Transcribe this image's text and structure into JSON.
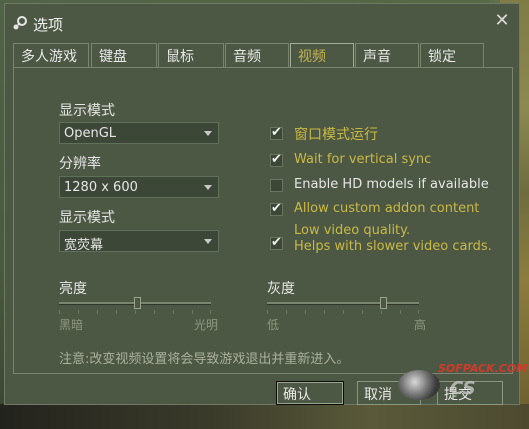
{
  "window": {
    "title": "选项",
    "close_glyph": "✕"
  },
  "tabs": [
    {
      "label": "多人游戏"
    },
    {
      "label": "键盘"
    },
    {
      "label": "鼠标"
    },
    {
      "label": "音频"
    },
    {
      "label": "视频",
      "active": true
    },
    {
      "label": "声音"
    },
    {
      "label": "锁定"
    }
  ],
  "video": {
    "display_mode_label": "显示模式",
    "renderer_value": "OpenGL",
    "resolution_label": "分辨率",
    "resolution_value": "1280 x 600",
    "display_mode2_label": "显示模式",
    "aspect_value": "宽荧幕",
    "options": [
      {
        "label": "窗口模式运行",
        "checked": true,
        "color": "#c9b945"
      },
      {
        "label": "Wait for vertical sync",
        "checked": true,
        "color": "#c9b945"
      },
      {
        "label": "Enable HD models if available",
        "checked": false,
        "color": "#e6e6e6"
      },
      {
        "label": "Allow custom addon content",
        "checked": true,
        "color": "#c9b945"
      },
      {
        "label_line1": "Low video quality.",
        "label_line2": "Helps with slower video cards.",
        "checked": true,
        "color": "#c9b945"
      }
    ],
    "brightness": {
      "label": "亮度",
      "min_label": "黑暗",
      "max_label": "光明",
      "value_fraction": 0.52
    },
    "gamma": {
      "label": "灰度",
      "min_label": "低",
      "max_label": "高",
      "value_fraction": 0.78
    },
    "notice": "注意:改变视频设置将会导致游戏退出并重新进入。"
  },
  "buttons": {
    "ok": "确认",
    "cancel": "取消",
    "apply": "提交"
  },
  "watermark": {
    "line1": "SOFPACK.COM",
    "line2": "CS"
  },
  "colors": {
    "accent": "#c4b550",
    "panel_bg": "#4c5844"
  }
}
